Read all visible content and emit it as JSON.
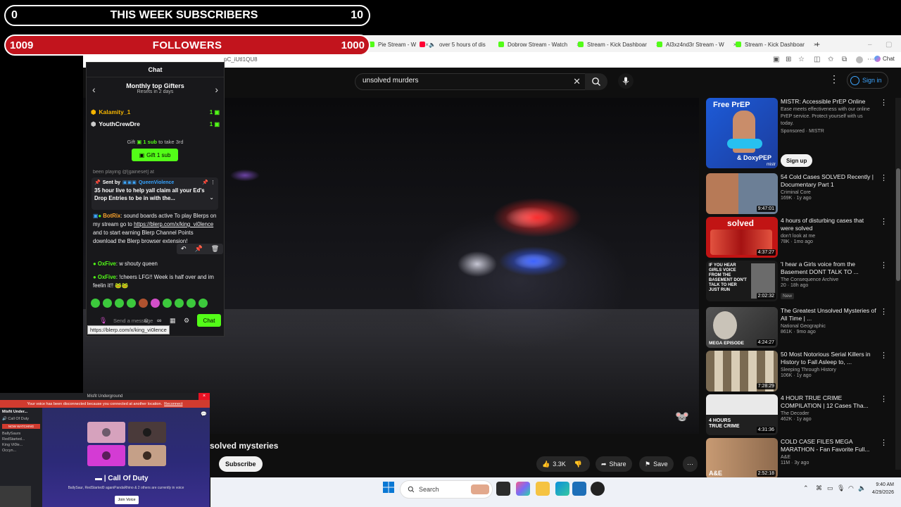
{
  "overlays": {
    "subs": {
      "left": "0",
      "title": "THIS WEEK SUBSCRIBERS",
      "right": "10"
    },
    "followers": {
      "left": "1009",
      "title": "FOLLOWERS",
      "right": "1000"
    }
  },
  "browser": {
    "tabs": [
      {
        "label": "Pie Stream - W",
        "icon": "kick"
      },
      {
        "label": "over 5 hours of dis",
        "icon": "youtube"
      },
      {
        "label": "Dobrow Stream - Watch",
        "icon": "kick"
      },
      {
        "label": "Stream - Kick Dashboar",
        "icon": "kick"
      },
      {
        "label": "Al3xz4nd3r Stream - W",
        "icon": "kick"
      },
      {
        "label": "Stream - Kick Dashboar",
        "icon": "kick"
      }
    ],
    "url_fragment": "pC_iUtI1QU8",
    "side_panel_label": "Chat"
  },
  "youtube": {
    "search_value": "unsolved murders",
    "sign_in": "Sign in",
    "video_title_partial": "solved mysteries",
    "subscribe": "Subscribe",
    "likes": "3.3K",
    "share": "Share",
    "save": "Save",
    "ad": {
      "title": "MISTR: Accessible PrEP Online",
      "desc": "Ease meets effectiveness with our online PrEP service. Protect yourself with us today.",
      "sponsor": "Sponsored · MISTR",
      "cta": "Sign up",
      "thumb_top": "Free PrEP",
      "thumb_bottom": "& DoxyPEP",
      "thumb_brand": "mistr"
    },
    "recommended": [
      {
        "title": "54 Cold Cases SOLVED Recently | Documentary Part 1",
        "channel": "Criminal Core",
        "stats": "169K · 1y ago",
        "duration": "9:47:01",
        "thumb_text": "",
        "badge": ""
      },
      {
        "title": "4 hours of disturbing cases that were solved",
        "channel": "don't look at me",
        "stats": "78K · 1mo ago",
        "duration": "4:37:27",
        "thumb_text": "solved",
        "badge": ""
      },
      {
        "title": "'I hear a Girls voice from the Basement  DONT TALK TO ...",
        "channel": "The Consequence Archive",
        "stats": "20 · 18h ago",
        "duration": "2:02:32",
        "thumb_text": "IF YOU HEAR GIRLS VOICE FROM THE BASEMENT DON'T TALK TO HER JUST RUN",
        "badge": "New"
      },
      {
        "title": "The Greatest Unsolved Mysteries of All Time | ...",
        "channel": "National Geographic",
        "stats": "861K · 9mo ago",
        "duration": "4:24:27",
        "thumb_text": "MEGA EPISODE",
        "badge": ""
      },
      {
        "title": "50 Most Notorious Serial Killers in History to Fall Asleep to, ...",
        "channel": "Sleeping Through History",
        "stats": "106K · 1y ago",
        "duration": "7:28:29",
        "thumb_text": "",
        "badge": ""
      },
      {
        "title": "4 HOUR TRUE CRIME COMPILATION | 12 Cases Tha...",
        "channel": "The Decoder",
        "stats": "462K · 1y ago",
        "duration": "4:31:36",
        "thumb_text": "4 HOURS TRUE CRIME",
        "badge": ""
      },
      {
        "title": "COLD CASE FILES MEGA MARATHON - Fan Favorite Full...",
        "channel": "A&E",
        "stats": "11M · 3y ago",
        "duration": "2:52:18",
        "thumb_text": "A&E",
        "badge": ""
      }
    ]
  },
  "chat": {
    "header": "Chat",
    "gifters_title": "Monthly top Gifters",
    "gifters_sub": "Resets in 2 days",
    "gifters": [
      {
        "name": "Kalamity_1",
        "count": "1"
      },
      {
        "name": "YouthCrewDre",
        "count": "1"
      }
    ],
    "gift_prompt_pre": "Gift",
    "gift_prompt_bold": "1 sub",
    "gift_prompt_post": "to take 3rd",
    "gift_button": "Gift 1 sub",
    "cutoff_text": "been playing @[gaineset] at",
    "pinned_prefix": "Sent by",
    "pinned_user": "QueenViolence",
    "pinned_text": "35 hour live to help yall claim all your Ed's Drop Entries to be in with the...",
    "messages": [
      {
        "user": "BotRix",
        "text": "sound boards active To play Blerps on my stream go to",
        "link": "https://blerp.com/x/king_vi0lence",
        "tail": "and to start earning Blerp Channel Points download the Blerp browser extension!"
      },
      {
        "user": "OxFive",
        "text": "w shouty queen"
      },
      {
        "user": "OxFive",
        "text": "!cheers LFG!! Week is half over and im feelin it!!"
      }
    ],
    "input_placeholder": "Send a message",
    "send": "Chat",
    "tooltip": "https://blerp.com/x/king_vi0lence"
  },
  "discord": {
    "title": "Misfit Underground",
    "warning": "Your voice has been disconnected because you connected at another location.",
    "reconnect": "Reconnect",
    "server": "Misfit Under...",
    "voice_channel": "Call Of Duty",
    "section": "NOW WATCHING",
    "members": [
      "BallySaurs",
      "RedStarted...",
      "King Vi0le...",
      "Occyn..."
    ],
    "channel_big": "Call Of Duty",
    "desc": "BallySaur, RedStarted0 aganiPandaRhino & 2 others are currently in voice",
    "join": "Join Voice"
  },
  "taskbar": {
    "search": "Search",
    "time": "9:40 AM",
    "date": "4/29/2026"
  }
}
